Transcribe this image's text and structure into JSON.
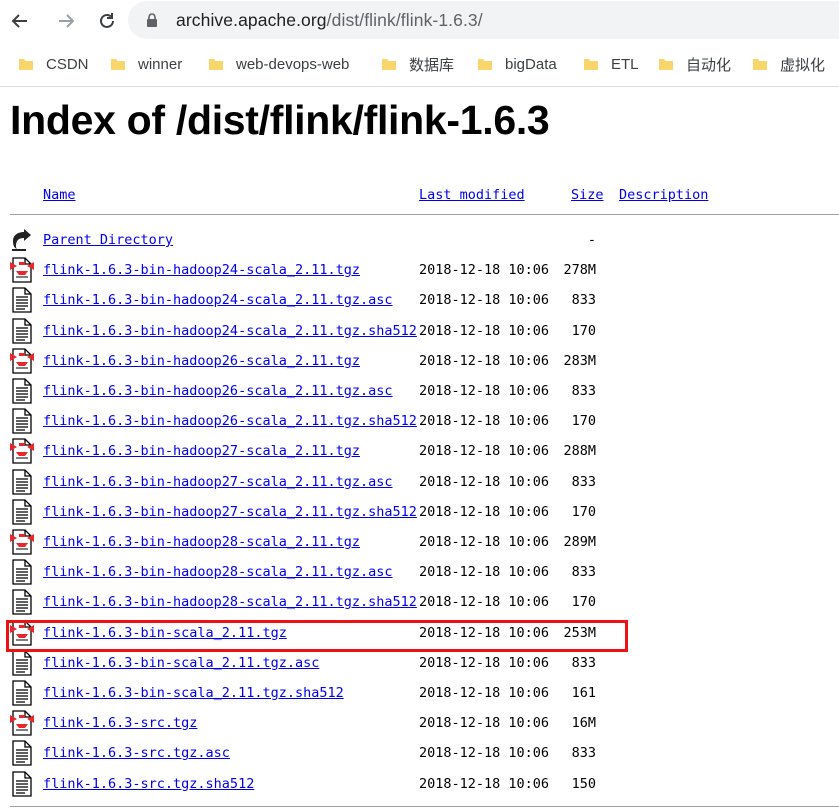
{
  "browser": {
    "url_host": "archive.apache.org",
    "url_path": "/dist/flink/flink-1.6.3/"
  },
  "bookmarks": [
    "CSDN",
    "winner",
    "web-devops-web",
    "数据库",
    "bigData",
    "ETL",
    "自动化",
    "虚拟化"
  ],
  "page": {
    "title": "Index of /dist/flink/flink-1.6.3",
    "columns": {
      "name": "Name",
      "modified": "Last modified",
      "size": "Size",
      "description": "Description"
    }
  },
  "listing": [
    {
      "name": "Parent Directory",
      "date": "",
      "size": "-",
      "icon": "back-icon"
    },
    {
      "name": "flink-1.6.3-bin-hadoop24-scala_2.11.tgz",
      "date": "2018-12-18 10:06",
      "size": "278M",
      "icon": "archive-icon"
    },
    {
      "name": "flink-1.6.3-bin-hadoop24-scala_2.11.tgz.asc",
      "date": "2018-12-18 10:06",
      "size": "833",
      "icon": "text-file-icon"
    },
    {
      "name": "flink-1.6.3-bin-hadoop24-scala_2.11.tgz.sha512",
      "date": "2018-12-18 10:06",
      "size": "170",
      "icon": "text-file-icon"
    },
    {
      "name": "flink-1.6.3-bin-hadoop26-scala_2.11.tgz",
      "date": "2018-12-18 10:06",
      "size": "283M",
      "icon": "archive-icon"
    },
    {
      "name": "flink-1.6.3-bin-hadoop26-scala_2.11.tgz.asc",
      "date": "2018-12-18 10:06",
      "size": "833",
      "icon": "text-file-icon"
    },
    {
      "name": "flink-1.6.3-bin-hadoop26-scala_2.11.tgz.sha512",
      "date": "2018-12-18 10:06",
      "size": "170",
      "icon": "text-file-icon"
    },
    {
      "name": "flink-1.6.3-bin-hadoop27-scala_2.11.tgz",
      "date": "2018-12-18 10:06",
      "size": "288M",
      "icon": "archive-icon"
    },
    {
      "name": "flink-1.6.3-bin-hadoop27-scala_2.11.tgz.asc",
      "date": "2018-12-18 10:06",
      "size": "833",
      "icon": "text-file-icon"
    },
    {
      "name": "flink-1.6.3-bin-hadoop27-scala_2.11.tgz.sha512",
      "date": "2018-12-18 10:06",
      "size": "170",
      "icon": "text-file-icon"
    },
    {
      "name": "flink-1.6.3-bin-hadoop28-scala_2.11.tgz",
      "date": "2018-12-18 10:06",
      "size": "289M",
      "icon": "archive-icon"
    },
    {
      "name": "flink-1.6.3-bin-hadoop28-scala_2.11.tgz.asc",
      "date": "2018-12-18 10:06",
      "size": "833",
      "icon": "text-file-icon"
    },
    {
      "name": "flink-1.6.3-bin-hadoop28-scala_2.11.tgz.sha512",
      "date": "2018-12-18 10:06",
      "size": "170",
      "icon": "text-file-icon"
    },
    {
      "name": "flink-1.6.3-bin-scala_2.11.tgz",
      "date": "2018-12-18 10:06",
      "size": "253M",
      "icon": "archive-icon"
    },
    {
      "name": "flink-1.6.3-bin-scala_2.11.tgz.asc",
      "date": "2018-12-18 10:06",
      "size": "833",
      "icon": "text-file-icon"
    },
    {
      "name": "flink-1.6.3-bin-scala_2.11.tgz.sha512",
      "date": "2018-12-18 10:06",
      "size": "161",
      "icon": "text-file-icon"
    },
    {
      "name": "flink-1.6.3-src.tgz",
      "date": "2018-12-18 10:06",
      "size": "16M",
      "icon": "archive-icon"
    },
    {
      "name": "flink-1.6.3-src.tgz.asc",
      "date": "2018-12-18 10:06",
      "size": "833",
      "icon": "text-file-icon"
    },
    {
      "name": "flink-1.6.3-src.tgz.sha512",
      "date": "2018-12-18 10:06",
      "size": "150",
      "icon": "text-file-icon"
    }
  ],
  "colors": {
    "link": "#0000ee",
    "highlight": "#ee1111",
    "folder": "#f9d66c"
  }
}
